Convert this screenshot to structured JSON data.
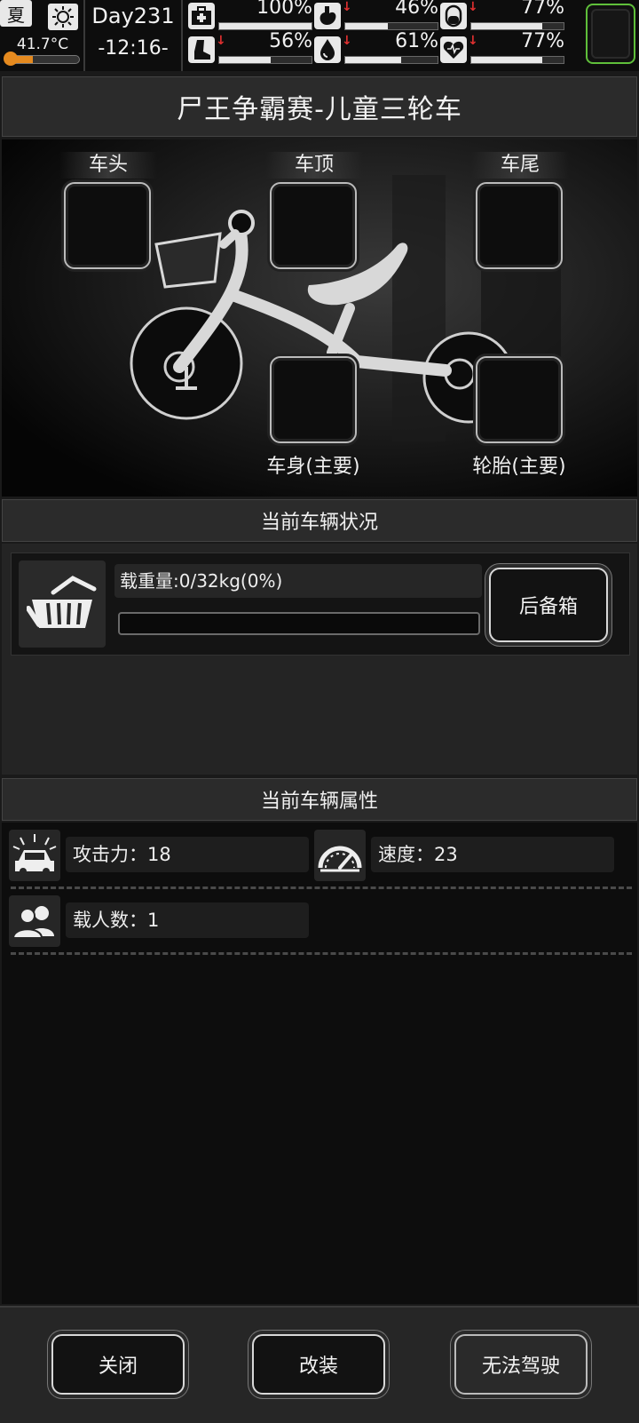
{
  "status_bar": {
    "season": "夏",
    "weather_icon": "sun-icon",
    "temperature": "41.7°C",
    "temperature_level": 0.35,
    "day": "Day231",
    "time": "-12:16-",
    "stats": [
      {
        "name": "health",
        "icon": "medkit-icon",
        "value": "100%",
        "level": 1.0,
        "falling": false
      },
      {
        "name": "hunger",
        "icon": "stomach-icon",
        "value": "46%",
        "level": 0.46,
        "falling": true
      },
      {
        "name": "medicine",
        "icon": "pill-icon",
        "value": "77%",
        "level": 0.77,
        "falling": true
      },
      {
        "name": "stamina",
        "icon": "boot-icon",
        "value": "56%",
        "level": 0.56,
        "falling": true
      },
      {
        "name": "thirst",
        "icon": "water-drop-icon",
        "value": "61%",
        "level": 0.61,
        "falling": true
      },
      {
        "name": "mood",
        "icon": "heart-icon",
        "value": "77%",
        "level": 0.77,
        "falling": true
      }
    ],
    "avatar_border_color": "#5fbf3a"
  },
  "title": "尸王争霸赛-儿童三轮车",
  "slots": {
    "head": "车头",
    "roof": "车顶",
    "tail": "车尾",
    "body": "车身(主要)",
    "tire": "轮胎(主要)"
  },
  "vehicle_status": {
    "header": "当前车辆状况",
    "load_text": "载重量:0/32kg(0%)",
    "load_level": 0,
    "trunk_button": "后备箱"
  },
  "vehicle_attributes": {
    "header": "当前车辆属性",
    "attack": "攻击力：18",
    "speed": "速度：23",
    "capacity": "载人数：1"
  },
  "buttons": {
    "close": "关闭",
    "modify": "改装",
    "drive": "无法驾驶"
  }
}
